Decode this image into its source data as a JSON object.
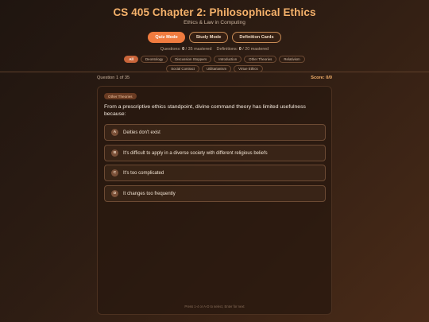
{
  "header": {
    "title": "CS 405 Chapter 2: Philosophical Ethics",
    "subtitle": "Ethics & Law in Computing"
  },
  "modes": [
    {
      "label": "Quiz Mode",
      "active": true
    },
    {
      "label": "Study Mode",
      "active": false
    },
    {
      "label": "Definition Cards",
      "active": false
    }
  ],
  "stats": {
    "questions_label": "Questions:",
    "questions_mastered": "0",
    "questions_rest": "/ 35 mastered",
    "definitions_label": "Definitions:",
    "definitions_mastered": "0",
    "definitions_rest": "/ 20 mastered"
  },
  "filters": [
    {
      "label": "All",
      "active": true
    },
    {
      "label": "Deontology",
      "active": false
    },
    {
      "label": "Discussion Stoppers",
      "active": false
    },
    {
      "label": "Introduction",
      "active": false
    },
    {
      "label": "Other Theories",
      "active": false
    },
    {
      "label": "Relativism",
      "active": false
    },
    {
      "label": "Social Contract",
      "active": false
    },
    {
      "label": "Utilitarianism",
      "active": false
    },
    {
      "label": "Virtue Ethics",
      "active": false
    }
  ],
  "progress": {
    "question_counter": "Question 1 of 35",
    "score": "Score: 0/0"
  },
  "quiz": {
    "topic": "Other Theories",
    "question": "From a prescriptive ethics standpoint, divine command theory has limited usefulness because:",
    "options": [
      {
        "letter": "A",
        "text": "Deities don't exist"
      },
      {
        "letter": "B",
        "text": "It's difficult to apply in a diverse society with different religious beliefs"
      },
      {
        "letter": "C",
        "text": "It's too complicated"
      },
      {
        "letter": "D",
        "text": "It changes too frequently"
      }
    ],
    "hint": "Press 1-4 or A-D to select, Enter for next"
  },
  "colors": {
    "accent": "#f07b3f",
    "title": "#f6b26b",
    "background_dark": "#1f1510",
    "background_light": "#4a2b18"
  }
}
